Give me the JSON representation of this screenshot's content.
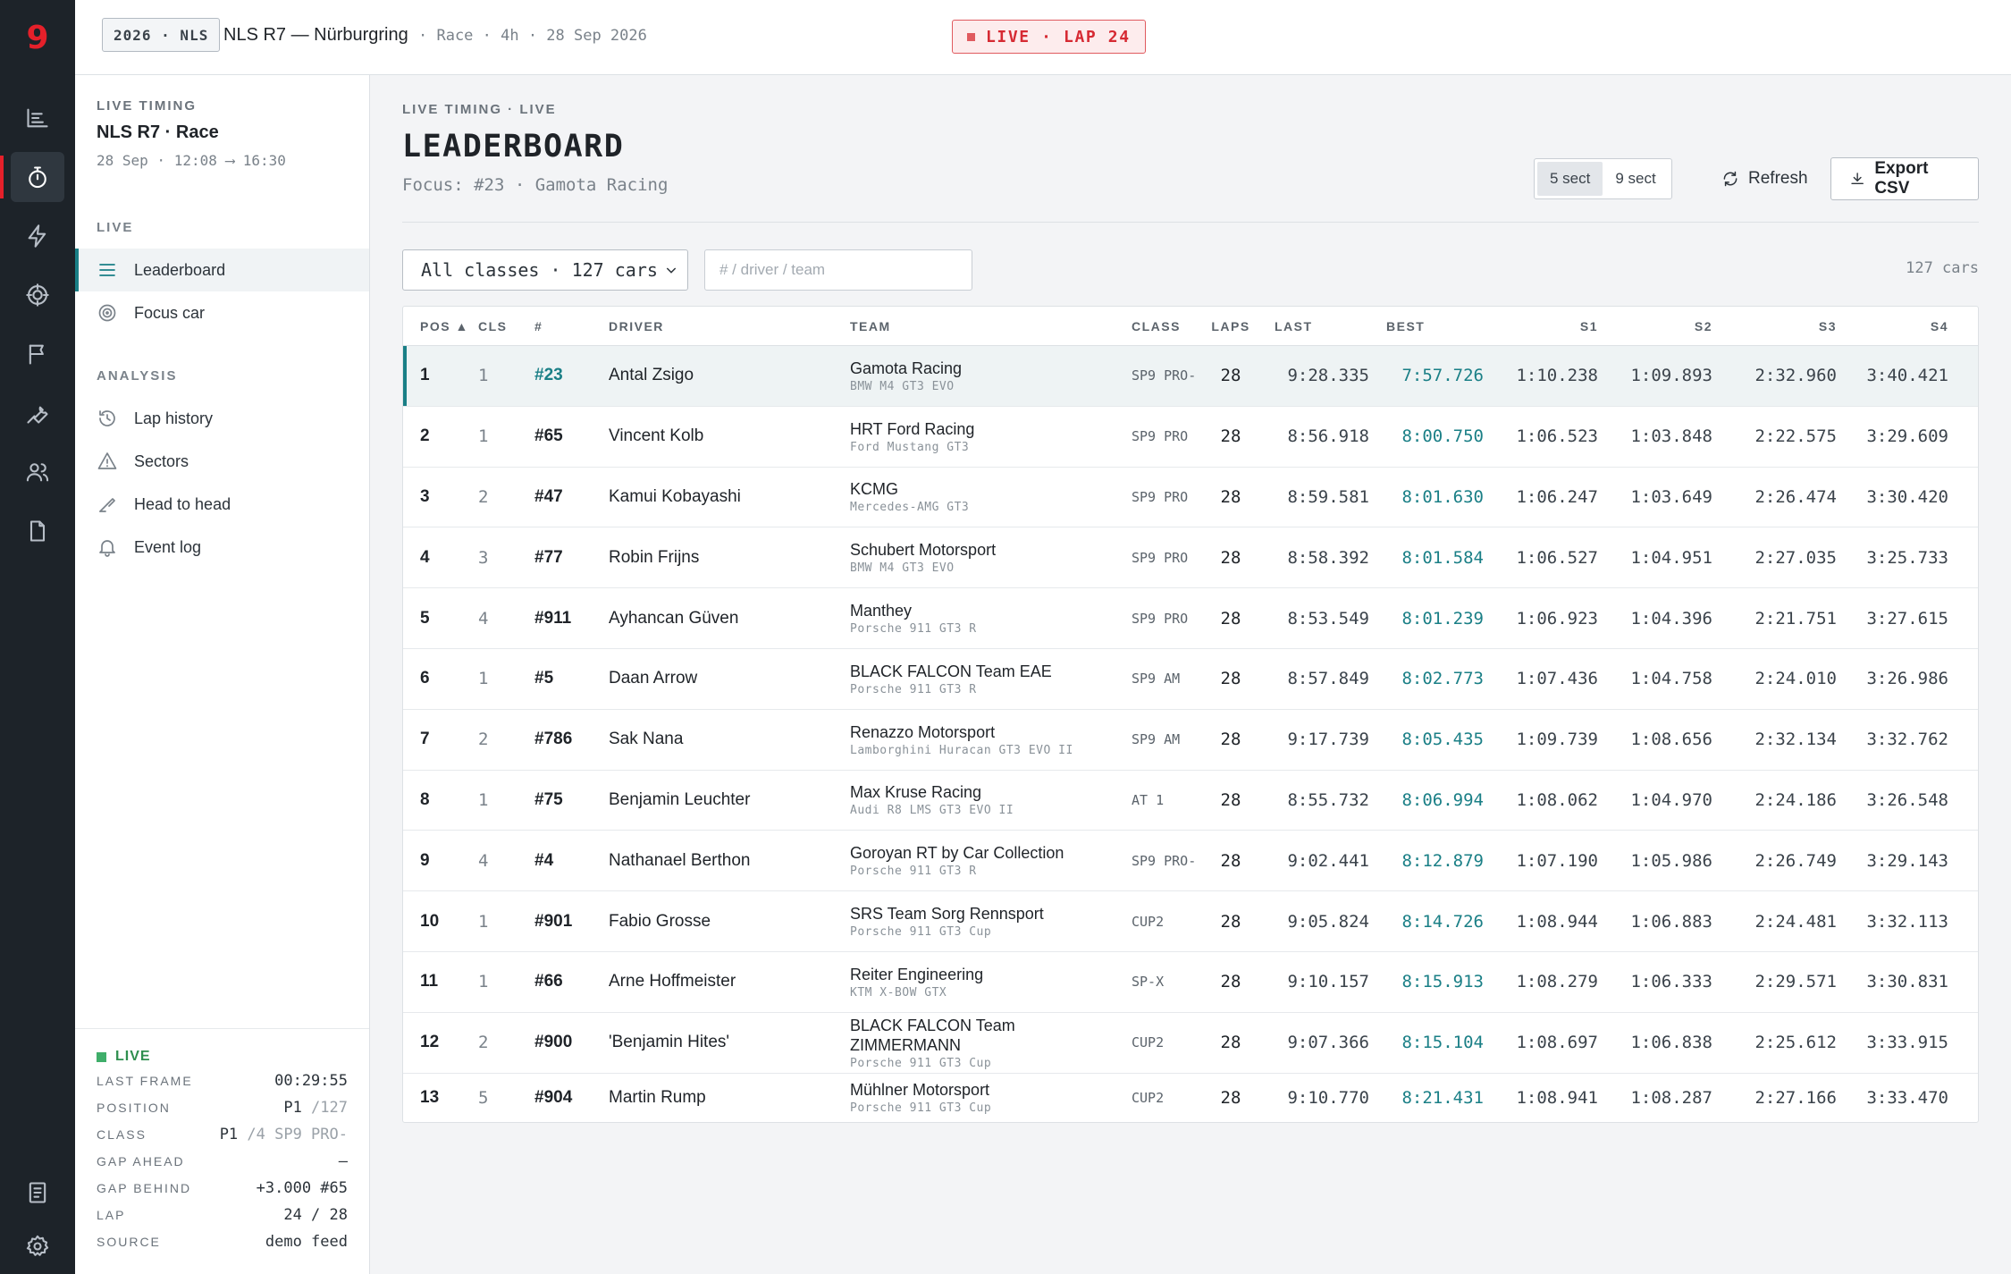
{
  "brand": {
    "logo_char": "9"
  },
  "topbar": {
    "season": "2026 · NLS",
    "event_title": "NLS R7 — Nürburgring",
    "event_meta": "· Race · 4h · 28 Sep 2026",
    "live_badge": "LIVE · LAP 24"
  },
  "rail": {
    "items": [
      "timeline-icon",
      "stopwatch-icon",
      "bolt-icon",
      "target-icon",
      "flag-icon",
      "wrench-icon",
      "users-icon",
      "document-icon"
    ],
    "bottom": [
      "report-icon",
      "gear-icon"
    ]
  },
  "sidebar": {
    "eyebrow": "LIVE TIMING",
    "title": "NLS R7 · Race",
    "time": "28 Sep · 12:08 ⟶ 16:30",
    "live_label": "LIVE",
    "live_items": [
      {
        "label": "Leaderboard",
        "icon": "list-icon"
      },
      {
        "label": "Focus car",
        "icon": "target-icon"
      }
    ],
    "analysis_label": "ANALYSIS",
    "analysis_items": [
      {
        "label": "Lap history",
        "icon": "history-icon"
      },
      {
        "label": "Sectors",
        "icon": "sectors-icon"
      },
      {
        "label": "Head to head",
        "icon": "compare-icon"
      },
      {
        "label": "Event log",
        "icon": "bell-icon"
      }
    ],
    "status": {
      "live": "LIVE",
      "rows": [
        {
          "k": "LAST FRAME",
          "v": "00:29:55",
          "dim": ""
        },
        {
          "k": "POSITION",
          "v": "P1",
          "dim": " /127"
        },
        {
          "k": "CLASS",
          "v": "P1",
          "dim": " /4 SP9 PRO-"
        },
        {
          "k": "GAP AHEAD",
          "v": "—",
          "dim": ""
        },
        {
          "k": "GAP BEHIND",
          "v": "+3.000 #65",
          "dim": ""
        },
        {
          "k": "LAP",
          "v": "24 / 28",
          "dim": ""
        },
        {
          "k": "SOURCE",
          "v": "demo feed",
          "dim": ""
        }
      ]
    }
  },
  "main": {
    "eyebrow": "LIVE TIMING · LIVE",
    "title": "LEADERBOARD",
    "focus": "Focus: #23 · Gamota Racing",
    "seg": [
      "5 sect",
      "9 sect"
    ],
    "refresh": "Refresh",
    "export": "Export CSV",
    "class_select": "All classes · 127 cars",
    "search_placeholder": "# / driver / team",
    "car_count": "127 cars",
    "columns": [
      "POS ▲",
      "CLS",
      "#",
      "DRIVER",
      "TEAM",
      "CLASS",
      "LAPS",
      "LAST",
      "BEST",
      "S1",
      "S2",
      "S3",
      "S4"
    ],
    "rows": [
      {
        "pos": "1",
        "cls": "1",
        "num": "#23",
        "driver": "Antal Zsigo",
        "team": "Gamota Racing",
        "car": "BMW M4 GT3 EVO",
        "class": "SP9 PRO-",
        "laps": "28",
        "last": "9:28.335",
        "best": "7:57.726",
        "s1": "1:10.238",
        "s2": "1:09.893",
        "s3": "2:32.960",
        "s4": "3:40.421"
      },
      {
        "pos": "2",
        "cls": "1",
        "num": "#65",
        "driver": "Vincent Kolb",
        "team": "HRT Ford Racing",
        "car": "Ford Mustang GT3",
        "class": "SP9 PRO",
        "laps": "28",
        "last": "8:56.918",
        "best": "8:00.750",
        "s1": "1:06.523",
        "s2": "1:03.848",
        "s3": "2:22.575",
        "s4": "3:29.609"
      },
      {
        "pos": "3",
        "cls": "2",
        "num": "#47",
        "driver": "Kamui Kobayashi",
        "team": "KCMG",
        "car": "Mercedes-AMG GT3",
        "class": "SP9 PRO",
        "laps": "28",
        "last": "8:59.581",
        "best": "8:01.630",
        "s1": "1:06.247",
        "s2": "1:03.649",
        "s3": "2:26.474",
        "s4": "3:30.420"
      },
      {
        "pos": "4",
        "cls": "3",
        "num": "#77",
        "driver": "Robin Frijns",
        "team": "Schubert Motorsport",
        "car": "BMW M4 GT3 EVO",
        "class": "SP9 PRO",
        "laps": "28",
        "last": "8:58.392",
        "best": "8:01.584",
        "s1": "1:06.527",
        "s2": "1:04.951",
        "s3": "2:27.035",
        "s4": "3:25.733"
      },
      {
        "pos": "5",
        "cls": "4",
        "num": "#911",
        "driver": "Ayhancan Güven",
        "team": "Manthey",
        "car": "Porsche 911 GT3 R",
        "class": "SP9 PRO",
        "laps": "28",
        "last": "8:53.549",
        "best": "8:01.239",
        "s1": "1:06.923",
        "s2": "1:04.396",
        "s3": "2:21.751",
        "s4": "3:27.615"
      },
      {
        "pos": "6",
        "cls": "1",
        "num": "#5",
        "driver": "Daan Arrow",
        "team": "BLACK FALCON Team EAE",
        "car": "Porsche 911 GT3 R",
        "class": "SP9 AM",
        "laps": "28",
        "last": "8:57.849",
        "best": "8:02.773",
        "s1": "1:07.436",
        "s2": "1:04.758",
        "s3": "2:24.010",
        "s4": "3:26.986"
      },
      {
        "pos": "7",
        "cls": "2",
        "num": "#786",
        "driver": "Sak Nana",
        "team": "Renazzo Motorsport",
        "car": "Lamborghini Huracan GT3 EVO II",
        "class": "SP9 AM",
        "laps": "28",
        "last": "9:17.739",
        "best": "8:05.435",
        "s1": "1:09.739",
        "s2": "1:08.656",
        "s3": "2:32.134",
        "s4": "3:32.762"
      },
      {
        "pos": "8",
        "cls": "1",
        "num": "#75",
        "driver": "Benjamin Leuchter",
        "team": "Max Kruse Racing",
        "car": "Audi R8 LMS GT3 EVO II",
        "class": "AT 1",
        "laps": "28",
        "last": "8:55.732",
        "best": "8:06.994",
        "s1": "1:08.062",
        "s2": "1:04.970",
        "s3": "2:24.186",
        "s4": "3:26.548"
      },
      {
        "pos": "9",
        "cls": "4",
        "num": "#4",
        "driver": "Nathanael Berthon",
        "team": "Goroyan RT by Car Collection",
        "car": "Porsche 911 GT3 R",
        "class": "SP9 PRO-",
        "laps": "28",
        "last": "9:02.441",
        "best": "8:12.879",
        "s1": "1:07.190",
        "s2": "1:05.986",
        "s3": "2:26.749",
        "s4": "3:29.143"
      },
      {
        "pos": "10",
        "cls": "1",
        "num": "#901",
        "driver": "Fabio Grosse",
        "team": "SRS Team Sorg Rennsport",
        "car": "Porsche 911 GT3 Cup",
        "class": "CUP2",
        "laps": "28",
        "last": "9:05.824",
        "best": "8:14.726",
        "s1": "1:08.944",
        "s2": "1:06.883",
        "s3": "2:24.481",
        "s4": "3:32.113"
      },
      {
        "pos": "11",
        "cls": "1",
        "num": "#66",
        "driver": "Arne Hoffmeister",
        "team": "Reiter Engineering",
        "car": "KTM X-BOW GTX",
        "class": "SP-X",
        "laps": "28",
        "last": "9:10.157",
        "best": "8:15.913",
        "s1": "1:08.279",
        "s2": "1:06.333",
        "s3": "2:29.571",
        "s4": "3:30.831"
      },
      {
        "pos": "12",
        "cls": "2",
        "num": "#900",
        "driver": "'Benjamin Hites'",
        "team": "BLACK FALCON Team ZIMMERMANN",
        "car": "Porsche 911 GT3 Cup",
        "class": "CUP2",
        "laps": "28",
        "last": "9:07.366",
        "best": "8:15.104",
        "s1": "1:08.697",
        "s2": "1:06.838",
        "s3": "2:25.612",
        "s4": "3:33.915"
      },
      {
        "pos": "13",
        "cls": "5",
        "num": "#904",
        "driver": "Martin Rump",
        "team": "Mühlner Motorsport",
        "car": "Porsche 911 GT3 Cup",
        "class": "CUP2",
        "laps": "28",
        "last": "9:10.770",
        "best": "8:21.431",
        "s1": "1:08.941",
        "s2": "1:08.287",
        "s3": "2:27.166",
        "s4": "3:33.470"
      }
    ]
  },
  "colors": {
    "brand_red": "#e5202a",
    "accent_teal": "#1a7f86",
    "live_green": "#3fae6a",
    "rail_bg": "#1d2329"
  }
}
